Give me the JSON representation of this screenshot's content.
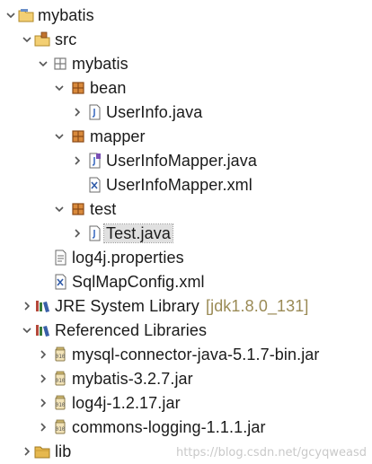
{
  "tree": {
    "project": "mybatis",
    "src": "src",
    "pkg_root": "mybatis",
    "pkg_bean": "bean",
    "file_userinfo": "UserInfo.java",
    "pkg_mapper": "mapper",
    "file_mapper_java": "UserInfoMapper.java",
    "file_mapper_xml": "UserInfoMapper.xml",
    "pkg_test": "test",
    "file_test": "Test.java",
    "file_log4j": "log4j.properties",
    "file_sqlmap": "SqlMapConfig.xml",
    "jre_label": "JRE System Library",
    "jre_decoration": "[jdk1.8.0_131]",
    "ref_libs": "Referenced Libraries",
    "jar_mysql": "mysql-connector-java-5.1.7-bin.jar",
    "jar_mybatis": "mybatis-3.2.7.jar",
    "jar_log4j": "log4j-1.2.17.jar",
    "jar_commons": "commons-logging-1.1.1.jar",
    "folder_lib": "lib"
  },
  "watermark": "https://blog.csdn.net/gcyqweasd",
  "icons": {
    "expanded": "chevron-down-icon",
    "collapsed": "chevron-right-icon",
    "project": "project-folder-icon",
    "source_folder": "source-folder-icon",
    "package": "package-icon",
    "java_file": "java-file-icon",
    "interface_file": "java-interface-icon",
    "xml_file": "xml-file-icon",
    "properties_file": "properties-file-icon",
    "library": "library-icon",
    "jar": "jar-icon",
    "folder": "folder-icon"
  },
  "colors": {
    "selection": "#e0e0e0",
    "decoration": "#9a8a55",
    "package": "#a0522d",
    "folder": "#e6b84f"
  }
}
